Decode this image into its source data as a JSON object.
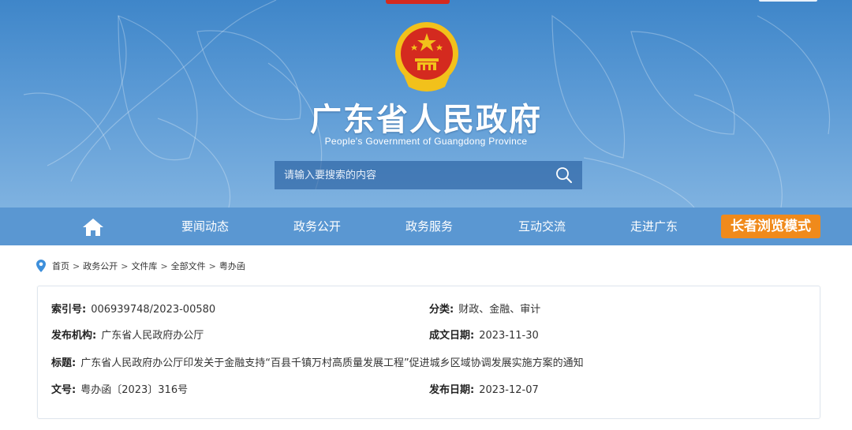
{
  "header": {
    "title": "广东省人民政府",
    "subtitle": "People's Government of Guangdong Province",
    "search_placeholder": "请输入要搜索的内容",
    "icons": {
      "emblem": "national-emblem-icon",
      "search": "search-icon"
    }
  },
  "nav": {
    "home_icon": "home-icon",
    "items": [
      "要闻动态",
      "政务公开",
      "政务服务",
      "互动交流",
      "走进广东"
    ],
    "elder_mode": "长者浏览模式"
  },
  "breadcrumb": [
    "首页",
    "政务公开",
    "文件库",
    "全部文件",
    "粤办函"
  ],
  "doc_info": {
    "index_label": "索引号:",
    "index_value": "006939748/2023-00580",
    "category_label": "分类:",
    "category_value": "财政、金融、审计",
    "issuer_label": "发布机构:",
    "issuer_value": "广东省人民政府办公厅",
    "written_label": "成文日期:",
    "written_value": "2023-11-30",
    "title_label": "标题:",
    "title_value": "广东省人民政府办公厅印发关于金融支持“百县千镇万村高质量发展工程”促进城乡区域协调发展实施方案的通知",
    "docno_label": "文号:",
    "docno_value": "粤办函〔2023〕316号",
    "publish_label": "发布日期:",
    "publish_value": "2023-12-07"
  },
  "colors": {
    "header_top": "#3f86c9",
    "header_bottom": "#7fb2e0",
    "nav_bg": "#5a97d2",
    "elder_btn": "#f08a1b",
    "emblem_red": "#d42a1f",
    "emblem_gold": "#f2c11b"
  }
}
